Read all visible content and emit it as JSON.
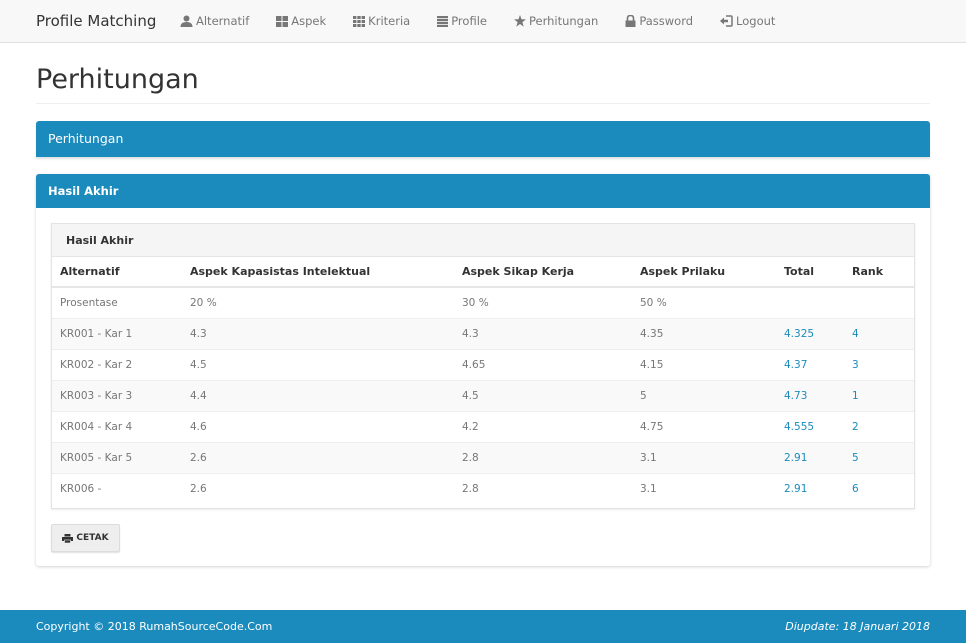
{
  "navbar": {
    "brand": "Profile Matching",
    "items": [
      {
        "label": "Alternatif",
        "icon": "user-icon"
      },
      {
        "label": "Aspek",
        "icon": "th-large-icon"
      },
      {
        "label": "Kriteria",
        "icon": "th-icon"
      },
      {
        "label": "Profile",
        "icon": "list-icon"
      },
      {
        "label": "Perhitungan",
        "icon": "star-icon"
      },
      {
        "label": "Password",
        "icon": "lock-icon"
      },
      {
        "label": "Logout",
        "icon": "logout-icon"
      }
    ]
  },
  "page": {
    "title": "Perhitungan",
    "panel_title": "Perhitungan",
    "result_panel_title": "Hasil Akhir",
    "table_title": "Hasil Akhir"
  },
  "table": {
    "headers": [
      "Alternatif",
      "Aspek Kapasistas Intelektual",
      "Aspek Sikap Kerja",
      "Aspek Prilaku",
      "Total",
      "Rank"
    ],
    "rows": [
      [
        "Prosentase",
        "20 %",
        "30 %",
        "50 %",
        "",
        ""
      ],
      [
        "KR001 - Kar 1",
        "4.3",
        "4.3",
        "4.35",
        "4.325",
        "4"
      ],
      [
        "KR002 - Kar 2",
        "4.5",
        "4.65",
        "4.15",
        "4.37",
        "3"
      ],
      [
        "KR003 - Kar 3",
        "4.4",
        "4.5",
        "5",
        "4.73",
        "1"
      ],
      [
        "KR004 - Kar 4",
        "4.6",
        "4.2",
        "4.75",
        "4.555",
        "2"
      ],
      [
        "KR005 - Kar 5",
        "2.6",
        "2.8",
        "3.1",
        "2.91",
        "5"
      ],
      [
        "KR006 -",
        "2.6",
        "2.8",
        "3.1",
        "2.91",
        "6"
      ]
    ]
  },
  "actions": {
    "print_label": "CETAK"
  },
  "footer": {
    "copyright": "Copyright © 2018 RumahSourceCode.Com",
    "updated": "Diupdate: 18 Januari 2018"
  },
  "colors": {
    "primary": "#1b8bbd",
    "navbar_bg": "#f8f8f8"
  }
}
